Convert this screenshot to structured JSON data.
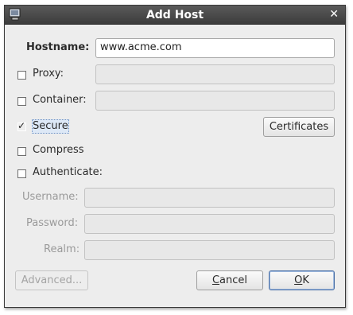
{
  "window": {
    "title": "Add Host"
  },
  "form": {
    "hostname_label": "Hostname:",
    "hostname_value": "www.acme.com",
    "proxy_label": "Proxy:",
    "proxy_checked": false,
    "container_label": "Container:",
    "container_checked": false,
    "secure_label": "Secure",
    "secure_checked": true,
    "certificates_button": "Certificates",
    "compress_label": "Compress",
    "compress_checked": false,
    "authenticate_label": "Authenticate:",
    "authenticate_checked": false,
    "username_label": "Username:",
    "password_label": "Password:",
    "realm_label": "Realm:"
  },
  "buttons": {
    "advanced": "Advanced...",
    "cancel_first": "C",
    "cancel_rest": "ancel",
    "ok_first": "O",
    "ok_rest": "K"
  },
  "icons": {
    "app": "monitor-icon",
    "close": "close-icon"
  }
}
